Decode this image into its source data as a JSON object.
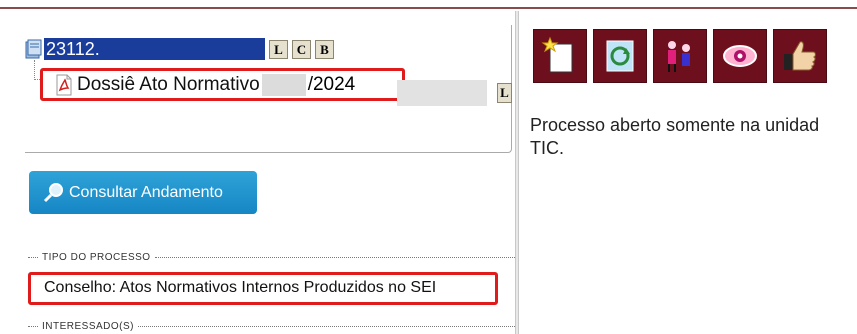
{
  "process": {
    "number": "23112.",
    "buttons": [
      "L",
      "C",
      "B"
    ]
  },
  "document": {
    "title": "Dossiê Ato Normativo",
    "year": "/2024",
    "button": "L"
  },
  "actions": {
    "consult_label": "Consultar Andamento"
  },
  "sections": {
    "type_label": "TIPO DO PROCESSO",
    "type_value": "Conselho: Atos Normativos Internos Produzidos no SEI",
    "interested_label": "INTERESSADO(S)"
  },
  "toolbar": {
    "icons": [
      "new-document-icon",
      "refresh-document-icon",
      "people-icon",
      "eye-icon",
      "thumbs-up-icon"
    ]
  },
  "status": {
    "line1": "Processo aberto somente na unidad",
    "line2": "TIC."
  },
  "colors": {
    "accent": "#6e0f1e",
    "highlight": "#e01b1b",
    "selection": "#1a3d9c",
    "button": "#1f90cc"
  }
}
